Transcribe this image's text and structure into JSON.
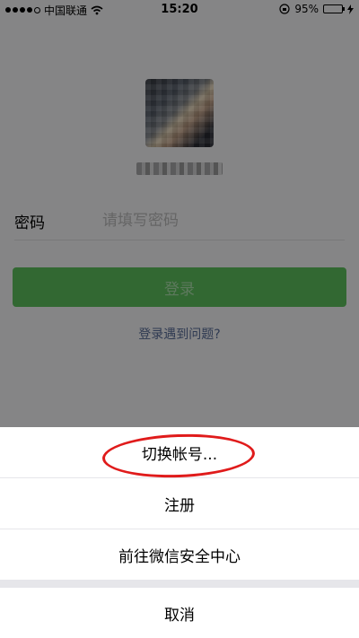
{
  "status_bar": {
    "carrier": "中国联通",
    "time": "15:20",
    "battery": "95%",
    "battery_level": 0.95,
    "icons": [
      "signal-dots-icon",
      "wifi-icon",
      "rotation-lock-icon",
      "battery-icon",
      "charging-icon"
    ]
  },
  "login": {
    "password_label": "密码",
    "password_placeholder": "请填写密码",
    "login_button": "登录",
    "trouble_link": "登录遇到问题?"
  },
  "action_sheet": {
    "switch_account": "切换帐号...",
    "register": "注册",
    "security_center": "前往微信安全中心",
    "cancel": "取消"
  },
  "colors": {
    "login_button": "#5bbd5b",
    "link": "#576b95",
    "annotation": "#e01b1b"
  }
}
